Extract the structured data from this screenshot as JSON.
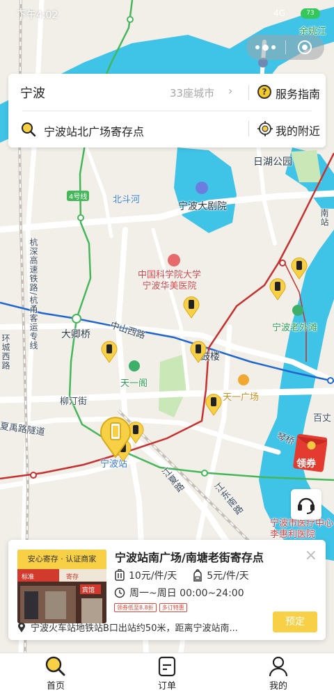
{
  "status_bar": {
    "time": "下午4:02",
    "battery": "73",
    "signal": "4G"
  },
  "search_card": {
    "city": "宁波",
    "city_count": "33座城市",
    "city_arrow": "›",
    "guide_label": "服务指南",
    "search_value": "宁波站北广场寄存点",
    "nearby_label": "我的附近"
  },
  "map": {
    "labels": {
      "yuyaojiang": "余姚江",
      "rihu_park": "日湖公园",
      "beidouhe": "北斗河",
      "line4": "4号线",
      "opera": "宁波大剧院",
      "hospital": "中国科学院大学\n宁波华美医院",
      "zhongshan": "中山西路",
      "dangqiao": "大卿桥",
      "gulou": "鼓楼",
      "laowaitan": "宁波老外滩",
      "tianyige": "天一阁",
      "tianyi_square": "天一广场",
      "liuting": "柳汀街",
      "xiayu": "夏禹路隧道",
      "baizhang": "百丈",
      "qinqiao": "琴桥",
      "ningbo_station": "宁波站",
      "jiangjia": "江夏路",
      "jiangdong": "江东南路",
      "medical": "宁波市医疗中心\n李惠利医院",
      "hangshen": "杭深高速铁路/杭甬客运专线",
      "huancheng": "环城西路",
      "nanzhan": "南站"
    }
  },
  "coupon": {
    "label": "领券"
  },
  "store": {
    "badge": "安心寄存 · 认证商家",
    "title": "宁波站南广场/南塘老街寄存点",
    "price_large": "10元/件/天",
    "price_small": "5元/件/天",
    "hours": "周一~周日 00:00~24:00",
    "tags": [
      "领券低至8.8折",
      "多订特惠"
    ],
    "address": "宁波火车站地铁站B口出站约50米，距离宁波站南...",
    "book_label": "预定",
    "close": "×",
    "thumb_sign_1": "标准",
    "thumb_sign_2": "寄存",
    "thumb_sign_3": "宾馆"
  },
  "tabs": [
    {
      "label": "首页",
      "icon": "search-icon"
    },
    {
      "label": "订单",
      "icon": "order-icon"
    },
    {
      "label": "我的",
      "icon": "person-icon"
    }
  ],
  "colors": {
    "accent": "#f7d046",
    "water": "#3fc3e6",
    "line_blue": "#3a7bd5",
    "line_red": "#c8302f",
    "line_green": "#46b65a",
    "park": "#c9e7b7"
  }
}
